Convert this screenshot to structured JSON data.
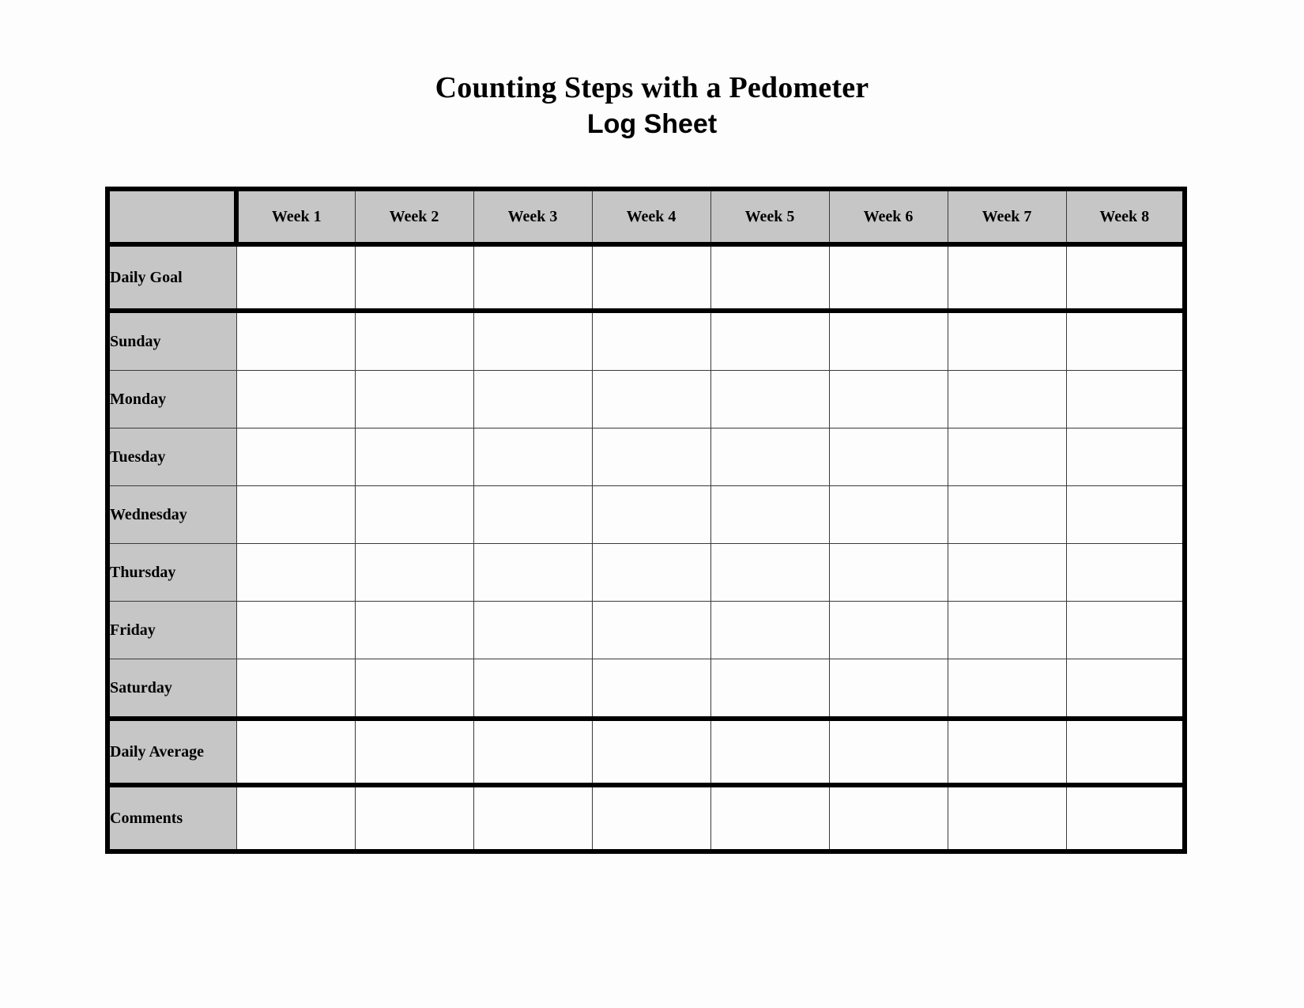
{
  "document": {
    "title_line_1": "Counting Steps with a Pedometer",
    "title_line_2": "Log Sheet"
  },
  "table": {
    "corner_label": "",
    "column_headers": [
      "Week 1",
      "Week 2",
      "Week 3",
      "Week 4",
      "Week 5",
      "Week 6",
      "Week 7",
      "Week 8"
    ],
    "rows": [
      {
        "label": "Daily Goal",
        "type": "goal",
        "values": [
          "",
          "",
          "",
          "",
          "",
          "",
          "",
          ""
        ]
      },
      {
        "label": "Sunday",
        "type": "day",
        "values": [
          "",
          "",
          "",
          "",
          "",
          "",
          "",
          ""
        ]
      },
      {
        "label": "Monday",
        "type": "day",
        "values": [
          "",
          "",
          "",
          "",
          "",
          "",
          "",
          ""
        ]
      },
      {
        "label": "Tuesday",
        "type": "day",
        "values": [
          "",
          "",
          "",
          "",
          "",
          "",
          "",
          ""
        ]
      },
      {
        "label": "Wednesday",
        "type": "day",
        "values": [
          "",
          "",
          "",
          "",
          "",
          "",
          "",
          ""
        ]
      },
      {
        "label": "Thursday",
        "type": "day",
        "values": [
          "",
          "",
          "",
          "",
          "",
          "",
          "",
          ""
        ]
      },
      {
        "label": "Friday",
        "type": "day",
        "values": [
          "",
          "",
          "",
          "",
          "",
          "",
          "",
          ""
        ]
      },
      {
        "label": "Saturday",
        "type": "day",
        "values": [
          "",
          "",
          "",
          "",
          "",
          "",
          "",
          ""
        ]
      },
      {
        "label": "Daily Average",
        "type": "average",
        "values": [
          "",
          "",
          "",
          "",
          "",
          "",
          "",
          ""
        ]
      },
      {
        "label": "Comments",
        "type": "comments",
        "values": [
          "",
          "",
          "",
          "",
          "",
          "",
          "",
          ""
        ]
      }
    ]
  },
  "colors": {
    "page_background": "#fdfdfd",
    "header_fill": "#c6c6c6",
    "label_fill": "#c6c6c6",
    "cell_fill": "#fdfdfd",
    "border_heavy": "#000000",
    "border_light": "#3a3a3a",
    "text": "#000000"
  }
}
